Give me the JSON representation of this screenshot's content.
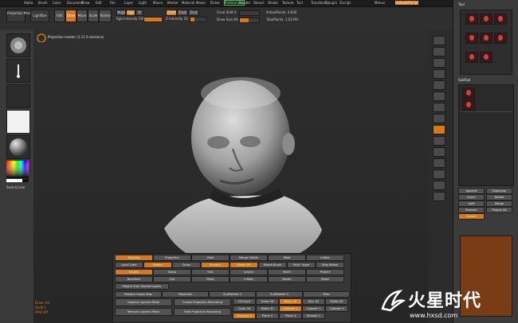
{
  "menu": {
    "items": [
      "Alpha",
      "Brush",
      "Color",
      "Document",
      "Draw",
      "Edit",
      "File",
      "Layer",
      "Light",
      "Macro",
      "Marker",
      "Material",
      "Movie",
      "Picker",
      "Preferences",
      "Render",
      "Stencil",
      "Stroke",
      "Texture",
      "Tool",
      "Transform",
      "Zplugin",
      "Zscript"
    ],
    "right": [
      "Menus",
      "DefaultZScript"
    ]
  },
  "toolbar": {
    "projection_master": "Projection Master",
    "lightbox": "LightBox",
    "quick_sketch": "Quick Sketch",
    "edit": "Edit",
    "draw": "Draw",
    "move": "Move",
    "scale": "Scale",
    "rotate": "Rotate",
    "mrgb": "Mrgb",
    "rgb": "Rgb",
    "m": "M",
    "zadd": "Zadd",
    "zsub": "Zsub",
    "zcut": "Zcut",
    "rgb_intensity": "Rgb Intensity 100",
    "z_intensity": "Z Intensity 25",
    "rgb_intensity_value": 100,
    "z_intensity_value": 25,
    "focal_shift": "Focal Shift 0",
    "draw_size": "Draw Size 64",
    "active_points": "ActivePoints: 4,630",
    "total_points": "TotalPoints: 1.02 Mil"
  },
  "viewport_tip": "Projection master (1.11 6 sessions)",
  "left_panel": {
    "color_label": "SwitchColor"
  },
  "right_shelf": [
    "BPR",
    "SPix",
    "Scroll",
    "Zoom",
    "Actual",
    "AAHalf",
    "Persp",
    "Floor",
    "Local",
    "Frame",
    "Move",
    "Scale",
    "Rotate",
    "PolyF",
    "Transp"
  ],
  "tray": {
    "header": "Tool",
    "buttons": [
      "Load Tool",
      "Save As",
      "Copy Tool",
      "Import",
      "Export",
      "Clone",
      "Make PolyMesh3D",
      "GoZ"
    ],
    "subtool_label": "SubTool",
    "list": [
      "Append",
      "Duplicate",
      "Insert",
      "Delete",
      "Split",
      "Merge",
      "Remesh",
      "Project All",
      "Extract"
    ]
  },
  "palette": {
    "tabs": [
      "Masking",
      "Projection",
      "Shell",
      "Merge Visible",
      "Weld",
      "Inflate"
    ],
    "row1": [
      "Local Light",
      "Rotate",
      "Draw",
      "Smooth",
      "Morph UV",
      "Morph Brush",
      "PolyF Uppe",
      "Stay Below"
    ],
    "row2": [
      "Double",
      "Sharp",
      "Smt",
      "Layers",
      "ReUV",
      "Project"
    ],
    "row3": [
      "Backface",
      "Clip",
      "Mask",
      "Inflate",
      "Morph",
      "Polish"
    ],
    "row4": [
      "Project from Shared Layers"
    ],
    "subheads": [
      "Restore Costly Map",
      "Projection",
      "SubPalette 2",
      "SubPalette 3",
      "Misc"
    ],
    "col_buttons": [
      "Capture Layered Mesh",
      "Remove Layered Mesh",
      "Create Projection Recording",
      "Hide Projection Recording"
    ],
    "bottom": [
      "Fill Front",
      "Erase 56",
      "Black 30",
      "Blur 30",
      "Polish 30",
      "Color 30",
      "Width 30",
      "Cylinder 1",
      "Cylinder 2",
      "Cylinder 3",
      "Sharpen 4",
      "Plane 2",
      "Plane 3",
      "Smooth 1"
    ]
  },
  "status": {
    "line1": "Draw: 64",
    "line2": "Zadd 1",
    "line3": "PPW Off"
  },
  "watermark": {
    "brand": "火星时代",
    "url": "www.hxsd.com"
  }
}
